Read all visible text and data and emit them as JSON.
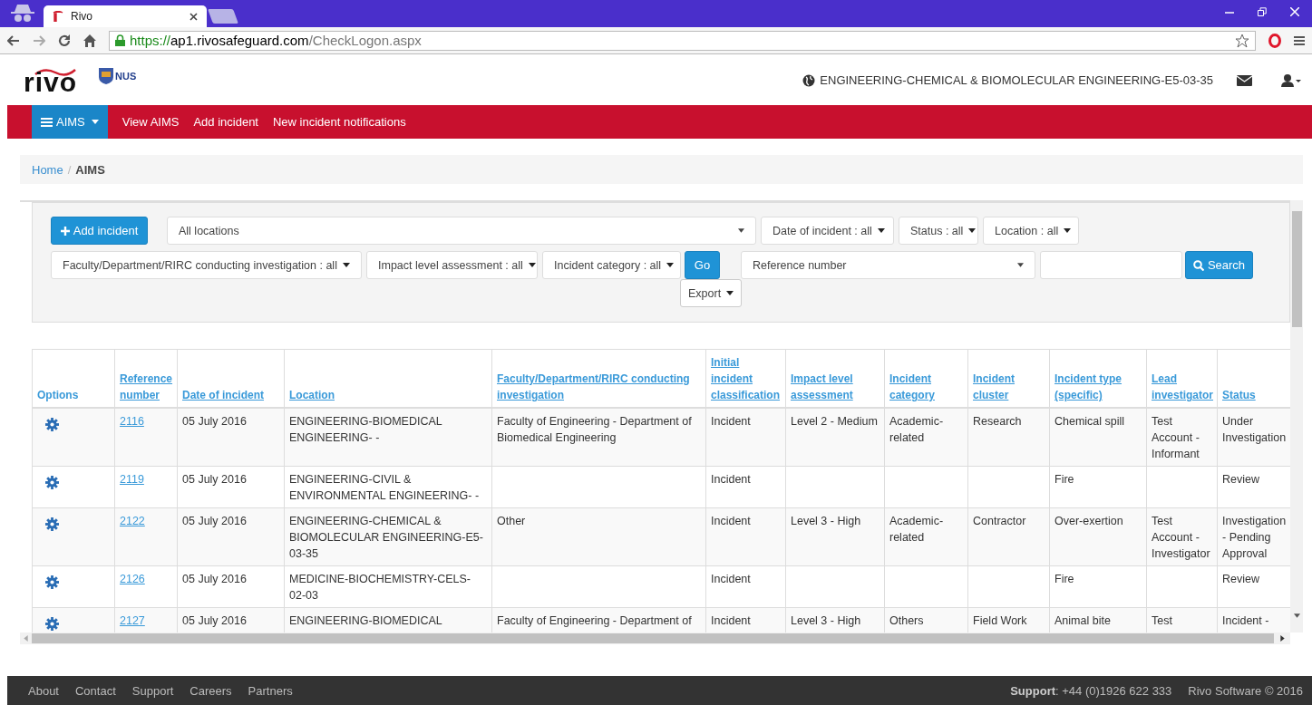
{
  "browser": {
    "tab_title": "Rivo",
    "url_scheme": "https://",
    "url_rest": "ap1.rivosafeguard.com",
    "url_path": "/CheckLogon.aspx"
  },
  "header": {
    "logo": "rivo",
    "partner_logo": "NUS",
    "location": "ENGINEERING-CHEMICAL & BIOMOLECULAR ENGINEERING-E5-03-35"
  },
  "nav": [
    {
      "label": "AIMS",
      "kind": "menu",
      "selected": true
    },
    {
      "label": "View AIMS",
      "kind": "link",
      "selected": false
    },
    {
      "label": "Add incident",
      "kind": "link",
      "selected": false
    },
    {
      "label": "New incident notifications",
      "kind": "link",
      "selected": false
    }
  ],
  "breadcrumb": {
    "separator": "/",
    "items": [
      {
        "label": "Home",
        "kind": "link"
      },
      {
        "label": "AIMS",
        "kind": "current"
      }
    ]
  },
  "filters": {
    "add_button": "Add incident",
    "location_select": "All locations",
    "dropdowns_top": [
      "Date of incident : all",
      "Status : all",
      "Location : all"
    ],
    "dropdowns_bottom": [
      "Faculty/Department/RIRC conducting investigation : all",
      "Impact level assessment : all",
      "Incident category : all"
    ],
    "go_button": "Go",
    "export_button": "Export",
    "search_select": "Reference number",
    "search_button": "Search"
  },
  "table": {
    "columns": [
      {
        "label": "Options",
        "kind": "plain"
      },
      {
        "label": "Reference number",
        "kind": "link"
      },
      {
        "label": "Date of incident",
        "kind": "link"
      },
      {
        "label": "Location",
        "kind": "link"
      },
      {
        "label": "Faculty/Department/RIRC conducting investigation",
        "kind": "link"
      },
      {
        "label": "Initial incident classification",
        "kind": "link"
      },
      {
        "label": "Impact level assessment",
        "kind": "link"
      },
      {
        "label": "Incident category",
        "kind": "link"
      },
      {
        "label": "Incident cluster",
        "kind": "link"
      },
      {
        "label": "Incident type (specific)",
        "kind": "link"
      },
      {
        "label": "Lead investigator",
        "kind": "link"
      },
      {
        "label": "Status",
        "kind": "link"
      }
    ],
    "rows": [
      {
        "ref": "2116",
        "date": "05 July 2016",
        "location": "ENGINEERING-BIOMEDICAL ENGINEERING- -",
        "faculty": "Faculty of Engineering - Department of Biomedical Engineering",
        "classification": "Incident",
        "impact": "Level 2 - Medium",
        "category": "Academic-related",
        "cluster": "Research",
        "type": "Chemical spill",
        "lead": "Test Account - Informant",
        "status": "Under Investigation"
      },
      {
        "ref": "2119",
        "date": "05 July 2016",
        "location": "ENGINEERING-CIVIL & ENVIRONMENTAL ENGINEERING- -",
        "classification": "Incident",
        "type": "Fire",
        "status": "Review"
      },
      {
        "ref": "2122",
        "date": "05 July 2016",
        "location": "ENGINEERING-CHEMICAL & BIOMOLECULAR ENGINEERING-E5-03-35",
        "faculty": "Other",
        "classification": "Incident",
        "impact": "Level 3 - High",
        "category": "Academic-related",
        "cluster": "Contractor",
        "type": "Over-exertion",
        "lead": "Test Account - Investigator",
        "status": "Investigation - Pending Approval"
      },
      {
        "ref": "2126",
        "date": "05 July 2016",
        "location": "MEDICINE-BIOCHEMISTRY-CELS-02-03",
        "classification": "Incident",
        "type": "Fire",
        "status": "Review"
      },
      {
        "ref": "2127",
        "date": "05 July 2016",
        "location": "ENGINEERING-BIOMEDICAL",
        "faculty": "Faculty of Engineering - Department of",
        "classification": "Incident",
        "impact": "Level 3 - High",
        "category": "Others",
        "cluster": "Field Work",
        "type": "Animal bite",
        "lead": "Test",
        "status": "Incident -"
      }
    ]
  },
  "footer": {
    "links": [
      "About",
      "Contact",
      "Support",
      "Careers",
      "Partners"
    ],
    "support_label": "Support",
    "support_text": ": +44 (0)1926 622 333",
    "copyright": "Rivo Software © 2016"
  }
}
